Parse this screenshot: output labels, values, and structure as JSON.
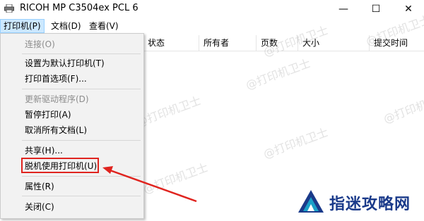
{
  "window": {
    "title": "RICOH MP C3504ex PCL 6",
    "min_glyph": "—",
    "max_glyph": "☐",
    "close_glyph": "✕"
  },
  "menubar": {
    "items": [
      {
        "label": "打印机(P)"
      },
      {
        "label": "文档(D)"
      },
      {
        "label": "查看(V)"
      }
    ]
  },
  "columns": [
    {
      "label": "状态"
    },
    {
      "label": "所有者"
    },
    {
      "label": "页数"
    },
    {
      "label": "大小"
    },
    {
      "label": "提交时间"
    }
  ],
  "dropdown": {
    "items": [
      {
        "label": "连接(O)",
        "disabled": true
      },
      {
        "label": "设置为默认打印机(T)",
        "disabled": false
      },
      {
        "label": "打印首选项(F)...",
        "disabled": false
      },
      {
        "label": "更新驱动程序(D)",
        "disabled": true
      },
      {
        "label": "暂停打印(A)",
        "disabled": false
      },
      {
        "label": "取消所有文档(L)",
        "disabled": false
      },
      {
        "label": "共享(H)...",
        "disabled": false
      },
      {
        "label": "脱机使用打印机(U)",
        "disabled": false,
        "highlighted": true
      },
      {
        "label": "属性(R)",
        "disabled": false
      },
      {
        "label": "关闭(C)",
        "disabled": false
      }
    ]
  },
  "watermark": {
    "text": "@打印机卫士"
  },
  "logo": {
    "text": "指迷攻略网"
  },
  "colors": {
    "highlight": "#e0241f",
    "logo_blue": "#1a3a8a",
    "logo_teal": "#1aa0c8"
  }
}
